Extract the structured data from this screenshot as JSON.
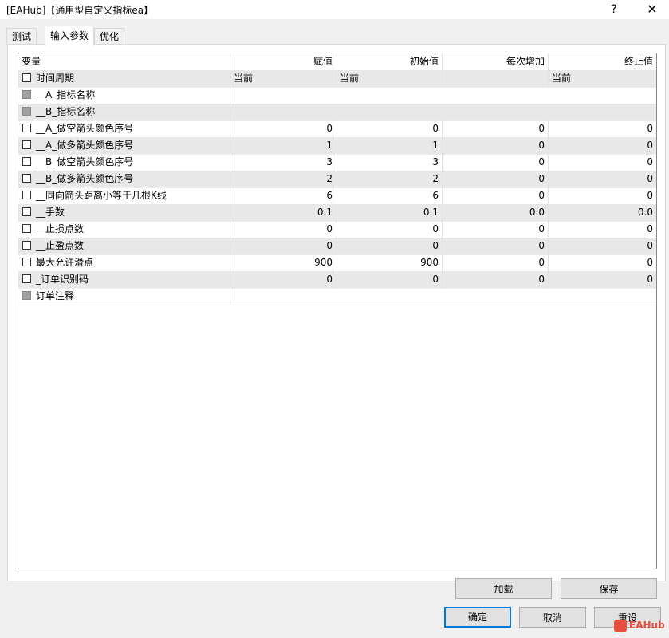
{
  "window": {
    "title": "[EAHub]【通用型自定义指标ea】",
    "help": "?",
    "close": "✕"
  },
  "tabs": [
    {
      "label": "测试"
    },
    {
      "label": "输入参数"
    },
    {
      "label": "优化"
    }
  ],
  "grid": {
    "headers": [
      "变量",
      "赋值",
      "初始值",
      "每次增加",
      "终止值"
    ],
    "rows": [
      {
        "name": "时间周期",
        "value": "当前",
        "start": "当前",
        "step": "",
        "stop": "当前",
        "disabled": false
      },
      {
        "name": "__A_指标名称",
        "value": "",
        "start": "",
        "step": "",
        "stop": "",
        "disabled": true
      },
      {
        "name": "__B_指标名称",
        "value": "",
        "start": "",
        "step": "",
        "stop": "",
        "disabled": true
      },
      {
        "name": "__A_做空箭头颜色序号",
        "value": "0",
        "start": "0",
        "step": "0",
        "stop": "0",
        "disabled": false
      },
      {
        "name": "__A_做多箭头颜色序号",
        "value": "1",
        "start": "1",
        "step": "0",
        "stop": "0",
        "disabled": false
      },
      {
        "name": "__B_做空箭头颜色序号",
        "value": "3",
        "start": "3",
        "step": "0",
        "stop": "0",
        "disabled": false
      },
      {
        "name": "__B_做多箭头颜色序号",
        "value": "2",
        "start": "2",
        "step": "0",
        "stop": "0",
        "disabled": false
      },
      {
        "name": "__同向箭头距离小等于几根K线",
        "value": "6",
        "start": "6",
        "step": "0",
        "stop": "0",
        "disabled": false
      },
      {
        "name": "__手数",
        "value": "0.1",
        "start": "0.1",
        "step": "0.0",
        "stop": "0.0",
        "disabled": false
      },
      {
        "name": "__止损点数",
        "value": "0",
        "start": "0",
        "step": "0",
        "stop": "0",
        "disabled": false
      },
      {
        "name": "__止盈点数",
        "value": "0",
        "start": "0",
        "step": "0",
        "stop": "0",
        "disabled": false
      },
      {
        "name": "最大允许滑点",
        "value": "900",
        "start": "900",
        "step": "0",
        "stop": "0",
        "disabled": false
      },
      {
        "name": "_订单识别码",
        "value": "0",
        "start": "0",
        "step": "0",
        "stop": "0",
        "disabled": false
      },
      {
        "name": "订单注释",
        "value": "",
        "start": "",
        "step": "",
        "stop": "",
        "disabled": true
      }
    ]
  },
  "buttons": {
    "load": "加载",
    "save": "保存",
    "ok": "确定",
    "cancel": "取消",
    "reset": "重设"
  },
  "watermark": "EAHub",
  "colors": {
    "accent": "#0078d7",
    "row_alt": "#e8e8e8",
    "watermark": "#e84d3d"
  }
}
